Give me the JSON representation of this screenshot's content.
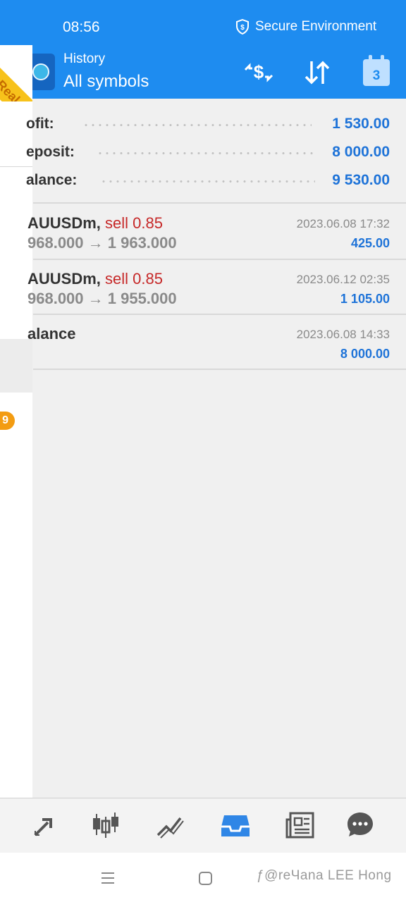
{
  "status_bar": {
    "time": "08:56",
    "secure_label": "Secure Environment"
  },
  "account_ribbon": "Real",
  "app_bar": {
    "subtitle": "History",
    "title": "All symbols",
    "calendar_day": "3",
    "icons": [
      "currency-exchange-icon",
      "sort-icon",
      "calendar-icon"
    ]
  },
  "drawer": {
    "badge_count": "9"
  },
  "summary": [
    {
      "label": "ofit:",
      "value": "1 530.00"
    },
    {
      "label": "eposit:",
      "value": "8 000.00"
    },
    {
      "label": "alance:",
      "value": "9 530.00"
    }
  ],
  "history": [
    {
      "symbol": "AUUSDm,",
      "action": "sell 0.85",
      "prices": "968.000 → 1 963.000",
      "datetime": "2023.06.08 17:32",
      "amount": "425.00"
    },
    {
      "symbol": "AUUSDm,",
      "action": "sell 0.85",
      "prices": "968.000 → 1 955.000",
      "datetime": "2023.06.12 02:35",
      "amount": "1 105.00"
    },
    {
      "symbol": "alance",
      "action": "",
      "prices": "",
      "datetime": "2023.06.08 14:33",
      "amount": "8 000.00"
    }
  ],
  "bottom_nav": [
    "trade-icon",
    "chart-candles-icon",
    "trend-icon",
    "history-inbox-icon",
    "news-icon",
    "chat-icon"
  ],
  "colors": {
    "primary": "#1e8cf0",
    "value_blue": "#1e73d8",
    "sell_red": "#c62828",
    "badge_orange": "#f39c12",
    "ribbon_yellow": "#f7c21b"
  },
  "watermark": "ƒ@reЧana LEE Hong"
}
